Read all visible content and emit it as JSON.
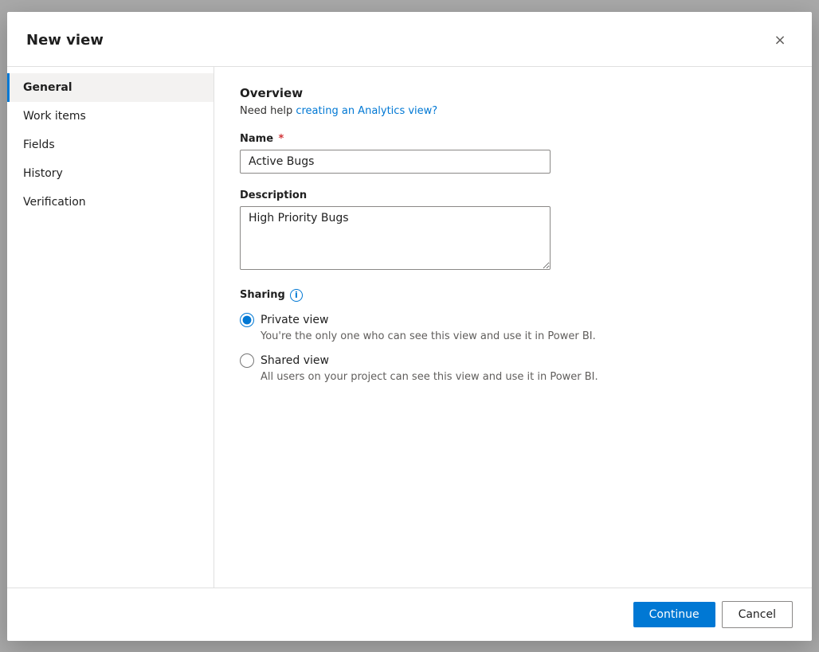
{
  "dialog": {
    "title": "New view",
    "close_label": "×"
  },
  "sidebar": {
    "items": [
      {
        "id": "general",
        "label": "General",
        "active": true
      },
      {
        "id": "work-items",
        "label": "Work items",
        "active": false
      },
      {
        "id": "fields",
        "label": "Fields",
        "active": false
      },
      {
        "id": "history",
        "label": "History",
        "active": false
      },
      {
        "id": "verification",
        "label": "Verification",
        "active": false
      }
    ]
  },
  "content": {
    "section_title": "Overview",
    "help_text": "Need help ",
    "help_link_text": "creating an Analytics view?",
    "help_link_href": "#",
    "name_label": "Name",
    "name_required": true,
    "name_value": "Active Bugs",
    "name_placeholder": "",
    "description_label": "Description",
    "description_value": "High Priority Bugs",
    "description_placeholder": "",
    "sharing_label": "Sharing",
    "sharing_info_icon": "i",
    "radio_options": [
      {
        "id": "private",
        "label": "Private view",
        "desc": "You're the only one who can see this view and use it in Power BI.",
        "checked": true
      },
      {
        "id": "shared",
        "label": "Shared view",
        "desc": "All users on your project can see this view and use it in Power BI.",
        "checked": false
      }
    ]
  },
  "footer": {
    "continue_label": "Continue",
    "cancel_label": "Cancel"
  }
}
